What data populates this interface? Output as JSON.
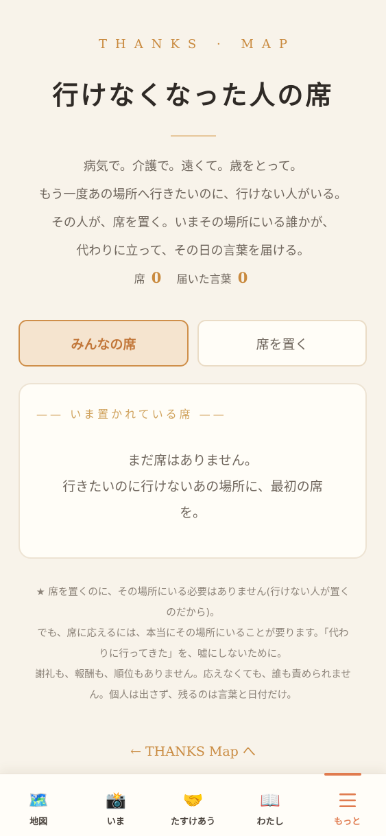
{
  "header": {
    "eyebrow": "THANKS · MAP",
    "title": "行けなくなった人の席"
  },
  "intro": {
    "lines": [
      "病気で。介護で。遠くて。歳をとって。",
      "もう一度あの場所へ行きたいのに、行けない人がいる。",
      "その人が、席を置く。いまその場所にいる誰かが、",
      "代わりに立って、その日の言葉を届ける。"
    ]
  },
  "stats": {
    "seats_label": "席",
    "seats_count": "0",
    "words_label": "届いた言葉",
    "words_count": "0"
  },
  "tabs": {
    "everyone": "みんなの席",
    "place_seat": "席を置く"
  },
  "seats": {
    "heading": "—— いま置かれている席 ——",
    "empty_lines": [
      "まだ席はありません。",
      "行きたいのに行けないあの場所に、最初の席",
      "を。"
    ]
  },
  "notes": {
    "lines": [
      "★ 席を置くのに、その場所にいる必要はありません(行けない人が置く",
      "のだから)。",
      "でも、席に応えるには、本当にその場所にいることが要ります。「代わ",
      "りに行ってきた」を、嘘にしないために。",
      "謝礼も、報酬も、順位もありません。応えなくても、誰も責められませ",
      "ん。個人は出さず、残るのは言葉と日付だけ。"
    ]
  },
  "back_link": "← THANKS Map へ",
  "nav": {
    "items": [
      {
        "label": "地図",
        "icon": "world-map-icon",
        "glyph": "🗺️"
      },
      {
        "label": "いま",
        "icon": "camera-flash-icon",
        "glyph": "📸"
      },
      {
        "label": "たすけあう",
        "icon": "handshake-icon",
        "glyph": "🤝"
      },
      {
        "label": "わたし",
        "icon": "open-book-icon",
        "glyph": "📖"
      },
      {
        "label": "もっと",
        "icon": "menu-icon",
        "glyph": "☰"
      }
    ],
    "active_index": 4
  },
  "colors": {
    "accent": "#c98a3f",
    "active_nav": "#e07b4f",
    "background": "#f8f3ea"
  }
}
